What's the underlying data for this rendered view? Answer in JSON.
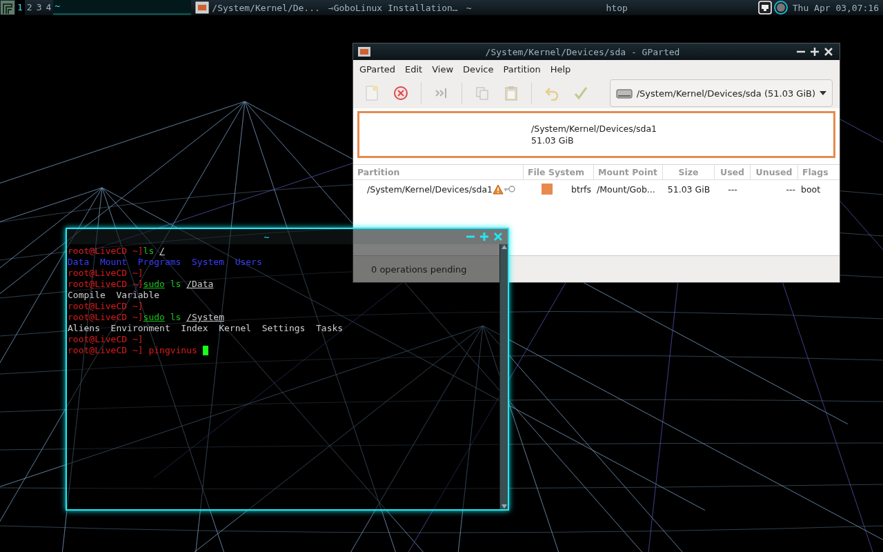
{
  "top_bar": {
    "workspaces": [
      {
        "label": "1",
        "selected": true
      },
      {
        "label": "2",
        "selected": false
      },
      {
        "label": "3",
        "selected": false
      },
      {
        "label": "4",
        "selected": false
      }
    ],
    "active_title": "~",
    "tasks": [
      {
        "label": "/System/Kernel/De...",
        "kind": "app"
      },
      {
        "label": "⇾GoboLinux Installation…",
        "kind": "plain"
      },
      {
        "label": "~",
        "kind": "plain"
      }
    ],
    "center_title": "htop",
    "clock": "Thu Apr 03,07:16"
  },
  "gparted": {
    "title": "/System/Kernel/Devices/sda - GParted",
    "menu": [
      "GParted",
      "Edit",
      "View",
      "Device",
      "Partition",
      "Help"
    ],
    "toolbar": [
      {
        "kind": "new",
        "disabled": true
      },
      {
        "kind": "delete",
        "disabled": false
      },
      {
        "kind": "sep"
      },
      {
        "kind": "resize",
        "disabled": true
      },
      {
        "kind": "sep"
      },
      {
        "kind": "copy",
        "disabled": true
      },
      {
        "kind": "paste",
        "disabled": true
      },
      {
        "kind": "sep"
      },
      {
        "kind": "undo",
        "disabled": true
      },
      {
        "kind": "apply",
        "disabled": true
      }
    ],
    "device": "/System/Kernel/Devices/sda (51.03 GiB)",
    "disk_map": {
      "name": "/System/Kernel/Devices/sda1",
      "size": "51.03 GiB"
    },
    "columns": [
      "Partition",
      "File System",
      "Mount Point",
      "Size",
      "Used",
      "Unused",
      "Flags"
    ],
    "rows": [
      {
        "partition": "/System/Kernel/Devices/sda1",
        "warning": true,
        "mounted": true,
        "color": "#e68a4d",
        "file_system": "btrfs",
        "mount_point": "/Mount/Gob...",
        "size": "51.03 GiB",
        "used": "---",
        "unused": "---",
        "flags": "boot"
      }
    ],
    "status": "0 operations pending"
  },
  "terminal": {
    "title": "~",
    "lines": [
      [
        {
          "text": "root@LiveCD ~]",
          "kind": "prompt"
        },
        {
          "text": "ls ",
          "kind": "command"
        },
        {
          "text": "/",
          "kind": "path"
        }
      ],
      [
        {
          "text": "Data  Mount  Programs  System  Users",
          "kind": "dir"
        }
      ],
      [
        {
          "text": "root@LiveCD ~]",
          "kind": "prompt"
        }
      ],
      [
        {
          "text": "root@LiveCD ~]",
          "kind": "prompt"
        },
        {
          "text": "sudo",
          "kind": "command_link"
        },
        {
          "text": " ls ",
          "kind": "command"
        },
        {
          "text": "/Data",
          "kind": "path"
        }
      ],
      [
        {
          "text": "Compile  Variable",
          "kind": "plain"
        }
      ],
      [
        {
          "text": "root@LiveCD ~]",
          "kind": "prompt"
        }
      ],
      [
        {
          "text": "root@LiveCD ~]",
          "kind": "prompt"
        },
        {
          "text": "sudo",
          "kind": "command_link"
        },
        {
          "text": " ls ",
          "kind": "command"
        },
        {
          "text": "/System",
          "kind": "path"
        }
      ],
      [
        {
          "text": "Aliens  Environment  Index  Kernel  Settings  Tasks",
          "kind": "plain"
        }
      ],
      [
        {
          "text": "root@LiveCD ~]",
          "kind": "prompt"
        }
      ],
      [
        {
          "text": "root@LiveCD ~]",
          "kind": "prompt"
        },
        {
          "text": " pingvinus ",
          "kind": "input"
        }
      ]
    ],
    "cursor": true
  }
}
